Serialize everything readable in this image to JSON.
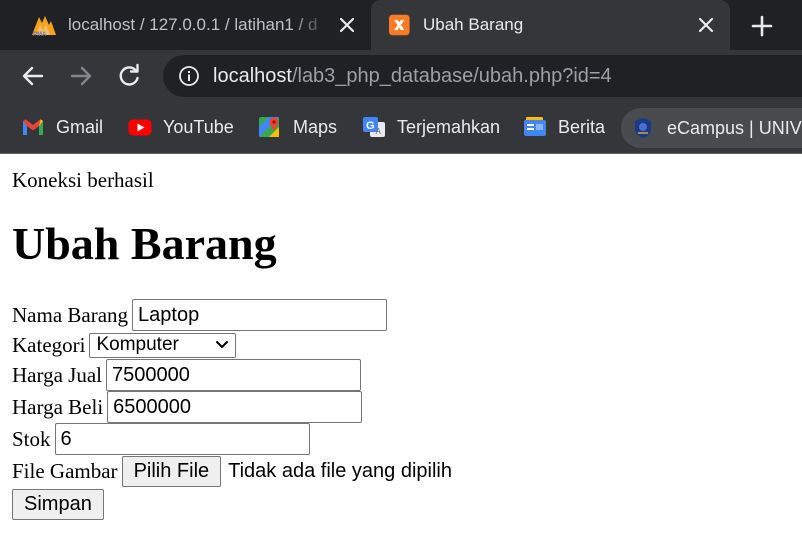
{
  "tabs": [
    {
      "title": "localhost / 127.0.0.1 / latihan1 / d",
      "icon": "phpmyadmin-icon",
      "active": false
    },
    {
      "title": "Ubah Barang",
      "icon": "xampp-icon",
      "active": true
    }
  ],
  "address_bar": {
    "host": "localhost",
    "path": "/lab3_php_database/ubah.php?id=4"
  },
  "bookmarks": [
    {
      "label": "Gmail",
      "icon": "gmail-icon"
    },
    {
      "label": "YouTube",
      "icon": "youtube-icon"
    },
    {
      "label": "Maps",
      "icon": "maps-icon"
    },
    {
      "label": "Terjemahkan",
      "icon": "translate-icon"
    },
    {
      "label": "Berita",
      "icon": "news-icon"
    },
    {
      "label": "eCampus | UNIVE",
      "icon": "ecampus-icon"
    }
  ],
  "page": {
    "status": "Koneksi berhasil",
    "title": "Ubah Barang",
    "form": {
      "nama_label": "Nama Barang",
      "nama_value": "Laptop",
      "kategori_label": "Kategori",
      "kategori_value": "Komputer",
      "harga_jual_label": "Harga Jual",
      "harga_jual_value": "7500000",
      "harga_beli_label": "Harga Beli",
      "harga_beli_value": "6500000",
      "stok_label": "Stok",
      "stok_value": "6",
      "file_label": "File Gambar",
      "file_button": "Pilih File",
      "file_status": "Tidak ada file yang dipilih",
      "submit": "Simpan"
    }
  },
  "colors": {
    "tabstrip_bg": "#202124",
    "toolbar_bg": "#35363a",
    "omnibox_bg": "#202124",
    "text_light": "#e8eaed",
    "text_dim": "#9aa0a6"
  }
}
